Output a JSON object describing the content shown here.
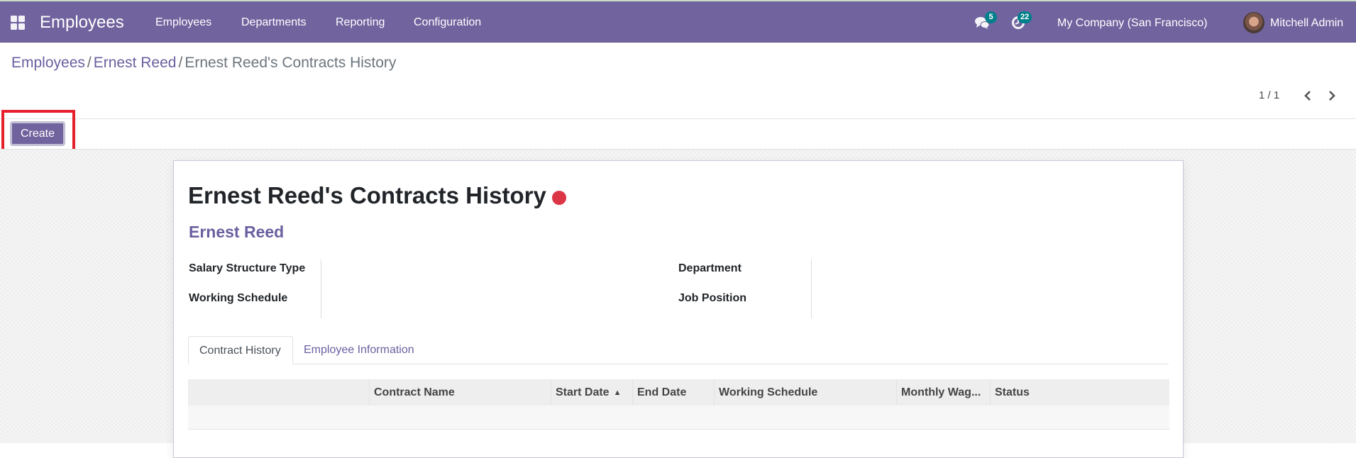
{
  "navbar": {
    "app_name": "Employees",
    "menu": [
      "Employees",
      "Departments",
      "Reporting",
      "Configuration"
    ],
    "messages_count": "5",
    "activities_count": "22",
    "company": "My Company (San Francisco)",
    "user": "Mitchell Admin",
    "color": "#71639e"
  },
  "breadcrumb": {
    "items": [
      "Employees",
      "Ernest Reed"
    ],
    "separator": "/",
    "active": "Ernest Reed's Contracts History"
  },
  "pager": {
    "value": "1 / 1"
  },
  "toolbar": {
    "create_label": "Create"
  },
  "form": {
    "title": "Ernest Reed's Contracts History",
    "status_color": "#dc3545",
    "employee": "Ernest Reed",
    "left_fields": [
      {
        "label": "Salary Structure Type",
        "value": ""
      },
      {
        "label": "Working Schedule",
        "value": ""
      }
    ],
    "right_fields": [
      {
        "label": "Department",
        "value": ""
      },
      {
        "label": "Job Position",
        "value": ""
      }
    ],
    "tabs": [
      "Contract History",
      "Employee Information"
    ],
    "active_tab": "Contract History",
    "table": {
      "columns": [
        "",
        "Contract Name",
        "Start Date",
        "End Date",
        "Working Schedule",
        "Monthly Wag...",
        "Status"
      ],
      "sorted_column": "Start Date",
      "sort_direction": "ascending",
      "rows": []
    }
  }
}
